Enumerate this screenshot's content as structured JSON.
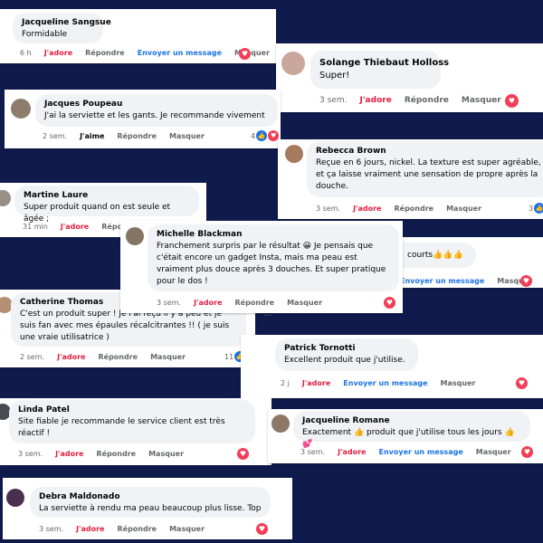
{
  "actions": {
    "love": "J'adore",
    "like": "J'aime",
    "reply": "Répondre",
    "hide": "Masquer",
    "message": "Envoyer un message"
  },
  "comments": [
    {
      "name": "Jacqueline Sangsue",
      "text": "Formidable",
      "time": "6 h"
    },
    {
      "name": "Solange Thiebaut Holloss",
      "text": "Super!",
      "time": "3 sem."
    },
    {
      "name": "Jacques Poupeau",
      "text": "J'ai la serviette et les gants. Je recommande vivement",
      "time": "2 sem.",
      "reactions": "4"
    },
    {
      "name": "Rebecca Brown",
      "text": "Reçue en 6 jours, nickel. La texture est super agréable, et ça laisse vraiment une sensation de propre après la douche.",
      "time": "3 sem.",
      "reactions": "3"
    },
    {
      "name": "Martine Laure",
      "text": "Super produit quand on est seule et âgée ;",
      "time": "31 min"
    },
    {
      "name": "Michelle Blackman",
      "text": "Franchement surpris par le résultat 😀 Je pensais que c'était encore un gadget Insta, mais ma peau est vraiment plus douce après 3 douches. Et super pratique pour le dos !",
      "time": "3 sem."
    },
    {
      "name": "",
      "text": "courts👍👍👍",
      "time": ""
    },
    {
      "name": "Catherine Thomas",
      "text": "C'est un produit super ! Je l'ai reçu il y a peu et je suis fan avec mes épaules récalcitrantes !! ( je suis une vraie utilisatrice )",
      "time": "2 sem.",
      "reactions": "11"
    },
    {
      "name": "Patrick Tornotti",
      "text": "Excellent produit que j'utilise.",
      "time": "2 j"
    },
    {
      "name": "Linda Patel",
      "text": "Site fiable je recommande le service client est très réactif !",
      "time": "3 sem."
    },
    {
      "name": "Jacqueline Romane",
      "text": "Exactement 👍 produit que j'utilise tous les jours 👍💕",
      "time": "3 sem."
    },
    {
      "name": "Debra Maldonado",
      "text": "La serviette à rendu ma peau beaucoup plus lisse. Top",
      "time": "3 sem."
    }
  ]
}
